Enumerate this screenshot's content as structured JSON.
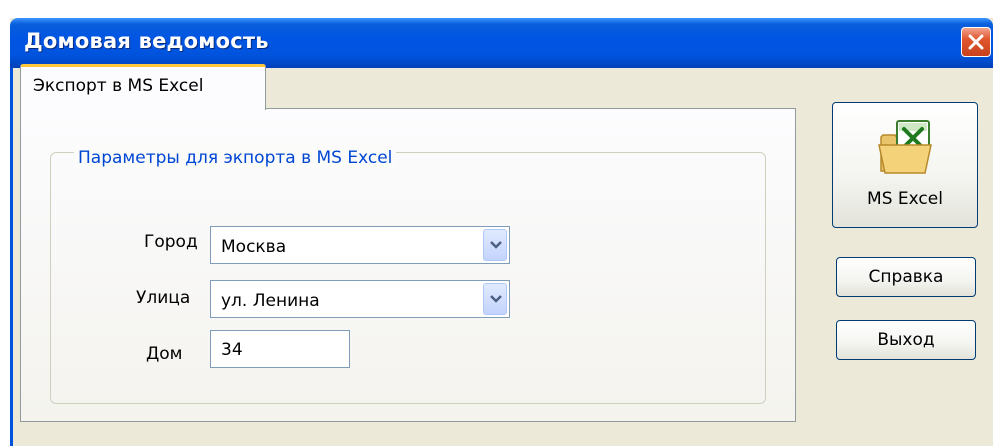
{
  "window": {
    "title": "Домовая ведомость"
  },
  "tabs": [
    {
      "label": "Экспорт в MS Excel"
    }
  ],
  "group": {
    "legend": "Параметры для экпорта в MS Excel"
  },
  "fields": {
    "city": {
      "label": "Город",
      "value": "Москва"
    },
    "street": {
      "label": "Улица",
      "value": "ул. Ленина"
    },
    "house": {
      "label": "Дом",
      "value": "34"
    }
  },
  "buttons": {
    "excel": {
      "label": "MS Excel",
      "icon": "excel-folder-icon"
    },
    "help": {
      "label": "Справка"
    },
    "exit": {
      "label": "Выход"
    }
  },
  "colors": {
    "titlebar": "#0053dd",
    "legend_text": "#0046d5",
    "close_button": "#e0562e",
    "active_tab_highlight": "#ffc83c"
  }
}
